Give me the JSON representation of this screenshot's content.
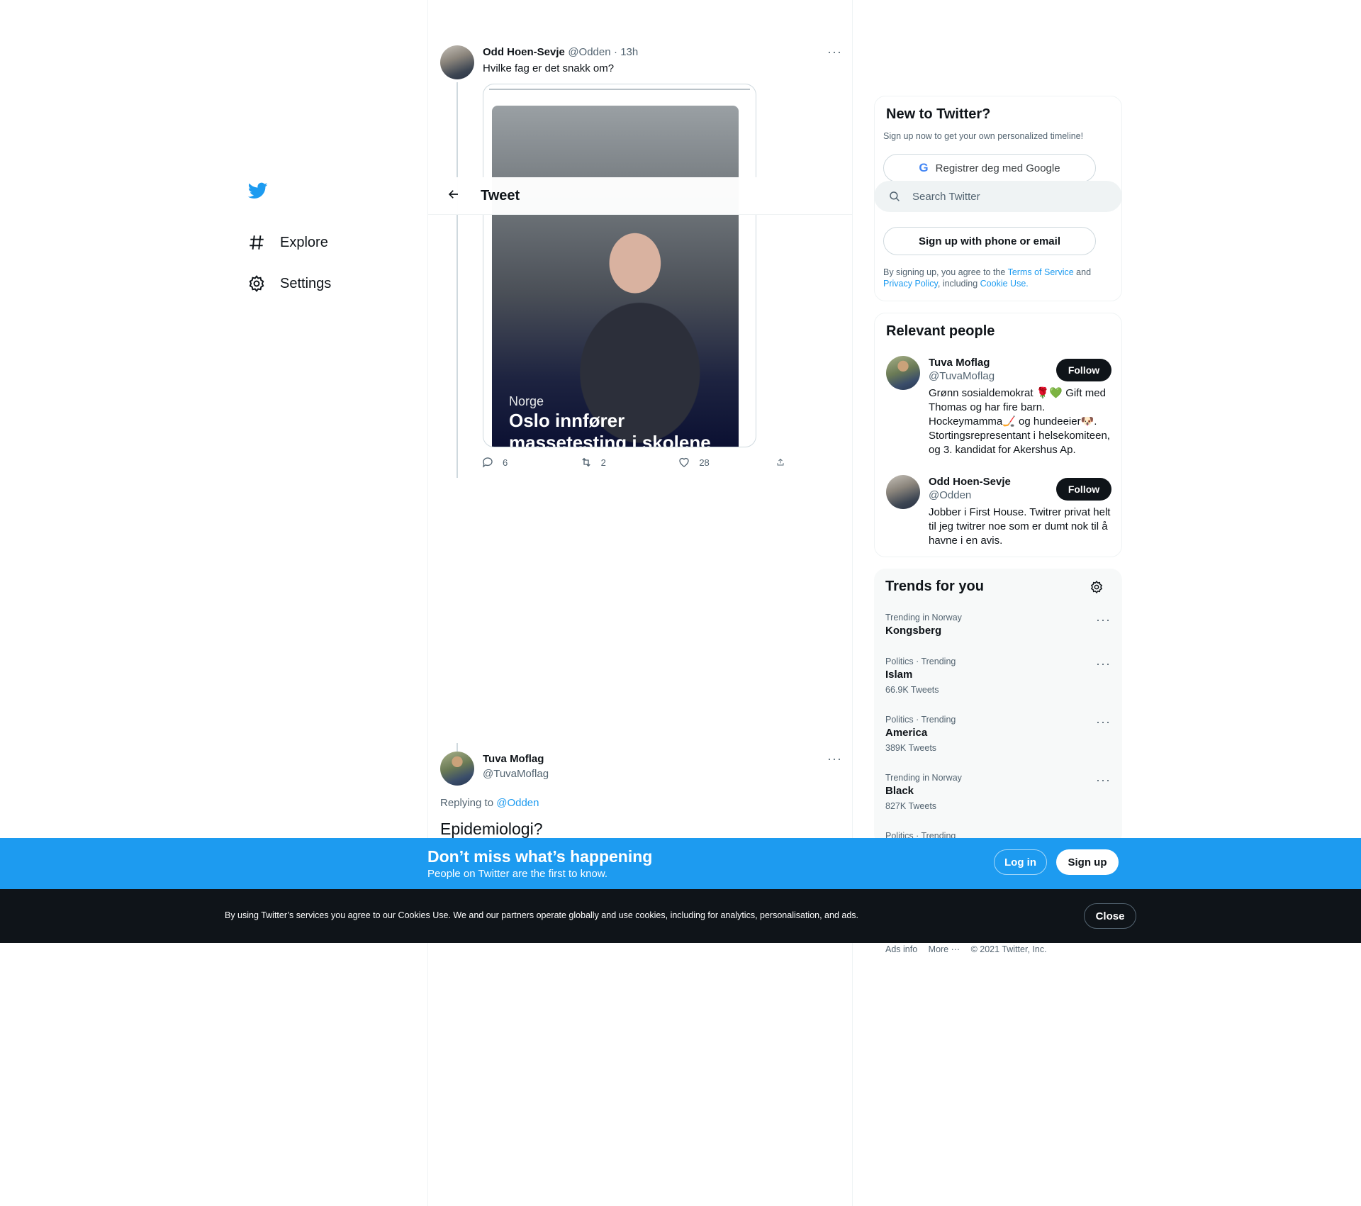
{
  "nav": {
    "items": [
      {
        "label": "Explore",
        "icon": "hashtag-icon"
      },
      {
        "label": "Settings",
        "icon": "gear-icon"
      }
    ]
  },
  "header": {
    "title": "Tweet"
  },
  "tweet1": {
    "name": "Odd Hoen-Sevje",
    "handle": "@Odden",
    "time": "· 13h",
    "text": "Hvilke fag er det snakk om?",
    "card": {
      "kicker": "Norge",
      "headline": "Oslo innfører massetesting i skolene"
    },
    "counts": {
      "replies": "6",
      "retweets": "2",
      "likes": "28"
    }
  },
  "tweet2": {
    "name": "Tuva Moflag",
    "handle": "@TuvaMoflag",
    "replying_prefix": "Replying to",
    "replying_to": "@Odden",
    "text": "Epidemiologi?"
  },
  "search": {
    "placeholder": "Search Twitter"
  },
  "signup": {
    "title": "New to Twitter?",
    "subtitle": "Sign up now to get your own personalized timeline!",
    "google_button": "Registrer deg med Google",
    "phone_button": "Sign up with phone or email",
    "legal_prefix": "By signing up, you agree to the",
    "terms": "Terms of Service",
    "and": "and",
    "privacy": "Privacy Policy",
    "including": ", including",
    "cookie": "Cookie Use."
  },
  "relevant": {
    "title": "Relevant people",
    "follow_label": "Follow",
    "people": [
      {
        "name": "Tuva Moflag",
        "handle": "@TuvaMoflag",
        "bio": "Grønn sosialdemokrat 🌹💚 Gift med Thomas og har fire barn. Hockeymamma🏒 og hundeeier🐶. Stortingsrepresentant i helsekomiteen, og 3. kandidat for Akershus Ap."
      },
      {
        "name": "Odd Hoen-Sevje",
        "handle": "@Odden",
        "bio": "Jobber i First House. Twitrer privat helt til jeg twitrer noe som er dumt nok til å havne i en avis."
      }
    ]
  },
  "trends": {
    "title": "Trends for you",
    "items": [
      {
        "context": "Trending in Norway",
        "topic": "Kongsberg",
        "count": ""
      },
      {
        "context": "Politics · Trending",
        "topic": "Islam",
        "count": "66.9K Tweets"
      },
      {
        "context": "Politics · Trending",
        "topic": "America",
        "count": "389K Tweets"
      },
      {
        "context": "Trending in Norway",
        "topic": "Black",
        "count": "827K Tweets"
      },
      {
        "context": "Politics · Trending",
        "topic": "",
        "count": ""
      }
    ]
  },
  "footer": {
    "ads": "Ads info",
    "more": "More ···",
    "copyright": "© 2021 Twitter, Inc."
  },
  "banner": {
    "headline": "Don’t miss what’s happening",
    "subline": "People on Twitter are the first to know.",
    "login": "Log in",
    "signup": "Sign up"
  },
  "cookie_bar": {
    "text": "By using Twitter’s services you agree to our Cookies Use. We and our partners operate globally and use cookies, including for analytics, personalisation, and ads.",
    "close": "Close"
  },
  "colors": {
    "accent": "#1d9bf0",
    "dark": "#0f1419",
    "muted": "#536471"
  }
}
